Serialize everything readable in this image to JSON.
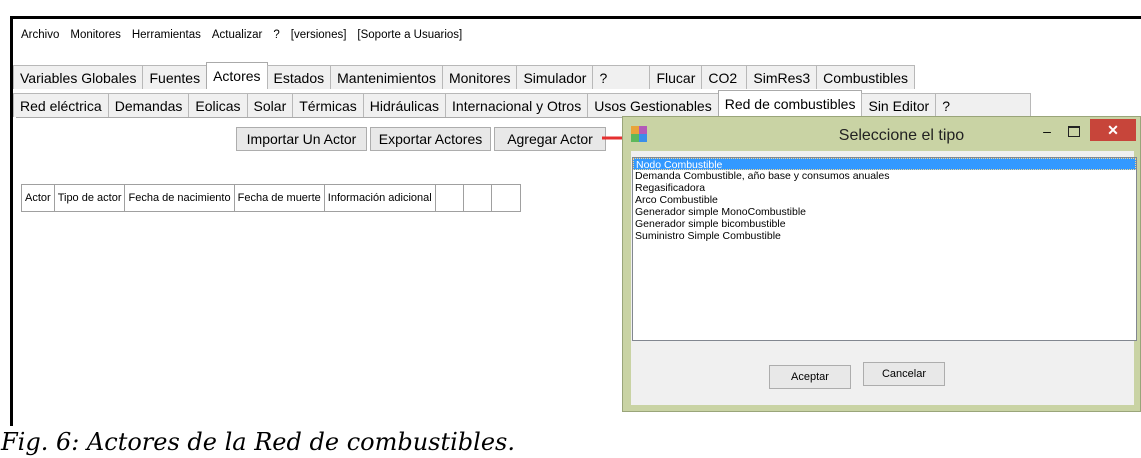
{
  "menubar": [
    "Archivo",
    "Monitores",
    "Herramientas",
    "Actualizar",
    "?",
    "[versiones]",
    "[Soporte a Usuarios]"
  ],
  "tabs_row1": [
    {
      "label": "Variables Globales",
      "w": 0
    },
    {
      "label": "Fuentes"
    },
    {
      "label": "Actores",
      "active": true
    },
    {
      "label": "Estados"
    },
    {
      "label": "Mantenimientos"
    },
    {
      "label": "Monitores"
    },
    {
      "label": "Simulador"
    },
    {
      "label": "?"
    },
    {
      "label": "Flucar"
    },
    {
      "label": "CO2"
    },
    {
      "label": "SimRes3"
    },
    {
      "label": "Combustibles"
    }
  ],
  "tabs_row2": [
    {
      "label": "Red eléctrica"
    },
    {
      "label": "Demandas"
    },
    {
      "label": "Eolicas"
    },
    {
      "label": "Solar"
    },
    {
      "label": "Térmicas"
    },
    {
      "label": "Hidráulicas"
    },
    {
      "label": "Internacional y Otros"
    },
    {
      "label": "Usos Gestionables"
    },
    {
      "label": "Red de combustibles",
      "active": true
    },
    {
      "label": "Sin Editor"
    },
    {
      "label": "?"
    }
  ],
  "toolbar": {
    "import_label": "Importar Un Actor",
    "export_label": "Exportar Actores",
    "add_label": "Agregar Actor"
  },
  "grid_headers": [
    "Actor",
    "Tipo de actor",
    "Fecha de nacimiento",
    "Fecha de muerte",
    "Información adicional"
  ],
  "dialog": {
    "title": "Seleccione el tipo",
    "items": [
      "Nodo Combustible",
      "Demanda Combustible, año base y consumos anuales",
      "Regasificadora",
      "Arco Combustible",
      "Generador simple MonoCombustible",
      "Generador simple bicombustible",
      "Suministro Simple Combustible"
    ],
    "selected_index": 0,
    "ok_label": "Aceptar",
    "cancel_label": "Cancelar",
    "minimize_glyph": "–",
    "close_glyph": "✕"
  },
  "caption": "Fig. 6: Actores de la Red de combustibles.",
  "colors": {
    "dialog_frame": "#c9d3a4",
    "close_button": "#c7453a",
    "selection": "#3399ff",
    "arrow": "#e53030"
  }
}
